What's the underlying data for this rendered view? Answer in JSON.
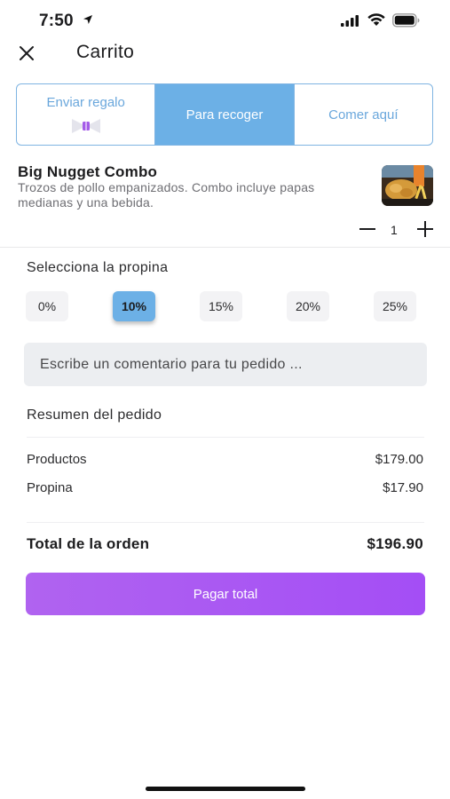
{
  "status_bar": {
    "time": "7:50"
  },
  "header": {
    "title": "Carrito",
    "close_icon": "close-icon"
  },
  "order_types": [
    {
      "label": "Enviar regalo",
      "icon": "gift-icon",
      "active": false
    },
    {
      "label": "Para recoger",
      "active": true
    },
    {
      "label": "Comer aquí",
      "active": false
    }
  ],
  "product": {
    "name": "Big Nugget Combo",
    "description": "Trozos de pollo empanizados. Combo incluye papas medianas y una bebida.",
    "quantity": "1"
  },
  "tips": {
    "title": "Selecciona la propina",
    "options": [
      "0%",
      "10%",
      "15%",
      "20%",
      "25%"
    ],
    "selected": "10%"
  },
  "comment": {
    "placeholder": "Escribe un comentario para tu pedido ..."
  },
  "summary": {
    "title": "Resumen del pedido",
    "rows": [
      {
        "label": "Productos",
        "value": "$179.00"
      },
      {
        "label": "Propina",
        "value": "$17.90"
      }
    ],
    "total_label": "Total de la orden",
    "total_value": "$196.90"
  },
  "pay_button": {
    "label": "Pagar total"
  },
  "colors": {
    "accent_blue": "#6cb0e6",
    "pay_purple": "#a44ef5"
  }
}
